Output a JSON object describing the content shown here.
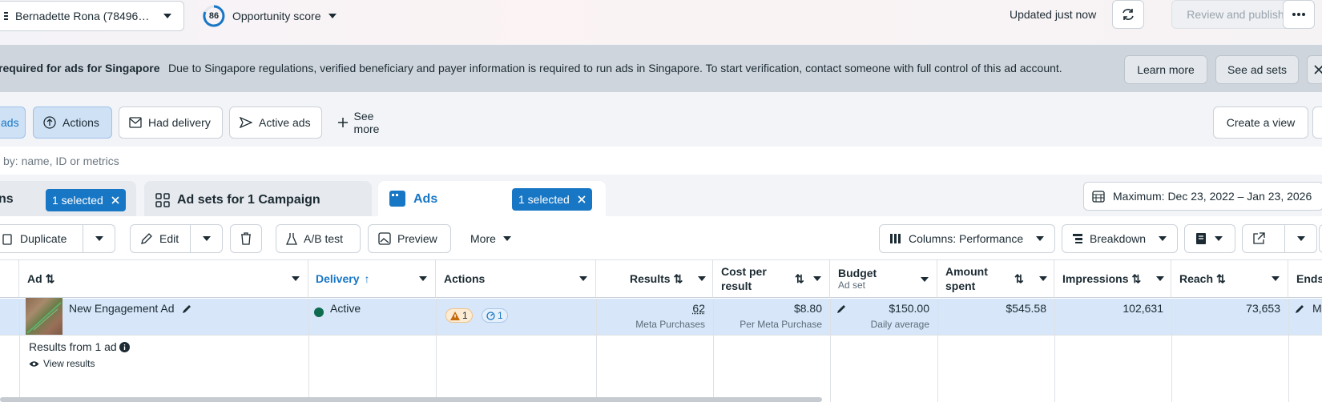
{
  "topbar": {
    "account_name": "Bernadette Rona (78496…",
    "score_value": "86",
    "score_label": "Opportunity score",
    "updated": "Updated just now",
    "publish_label": "Review and publish"
  },
  "banner": {
    "title": "required for ads for Singapore",
    "message": "Due to Singapore regulations, verified beneficiary and payer information is required to run ads in Singapore. To start verification, contact someone with full control of this ad account.",
    "learn_more": "Learn more",
    "see_ad_sets": "See ad sets"
  },
  "filters": {
    "items": [
      "ads",
      "Actions",
      "Had delivery",
      "Active ads",
      "See more"
    ],
    "create_view": "Create a view"
  },
  "search": {
    "placeholder": "by: name, ID or metrics"
  },
  "tabs": {
    "campaigns_partial": "ns",
    "campaigns_selected": "1 selected",
    "adsets": "Ad sets for 1 Campaign",
    "ads": "Ads",
    "ads_selected": "1 selected",
    "date_range": "Maximum: Dec 23, 2022 – Jan 23, 2026"
  },
  "toolbar": {
    "duplicate": "Duplicate",
    "edit": "Edit",
    "ab_test": "A/B test",
    "preview": "Preview",
    "more": "More",
    "columns": "Columns: Performance",
    "breakdown": "Breakdown"
  },
  "table": {
    "headers": {
      "ad": "Ad",
      "delivery": "Delivery",
      "actions": "Actions",
      "results": "Results",
      "cost_per_result": "Cost per result",
      "budget": "Budget",
      "budget_sub": "Ad set",
      "amount_spent": "Amount spent",
      "impressions": "Impressions",
      "reach": "Reach",
      "ends": "Ends"
    },
    "row": {
      "ad_name": "New Engagement Ad",
      "delivery": "Active",
      "warning_count": "1",
      "info_count": "1",
      "results": "62",
      "results_sub": "Meta Purchases",
      "cost": "$8.80",
      "cost_sub": "Per Meta Purchase",
      "budget": "$150.00",
      "budget_sub": "Daily average",
      "amount_spent": "$545.58",
      "impressions": "102,631",
      "reach": "73,653",
      "ends_partial": "M"
    },
    "summary": {
      "label": "Results from 1 ad",
      "view_results": "View results"
    }
  },
  "colors": {
    "accent": "#1877c5",
    "active_dot": "#0e6b4f",
    "warning": "#f0a03a"
  }
}
